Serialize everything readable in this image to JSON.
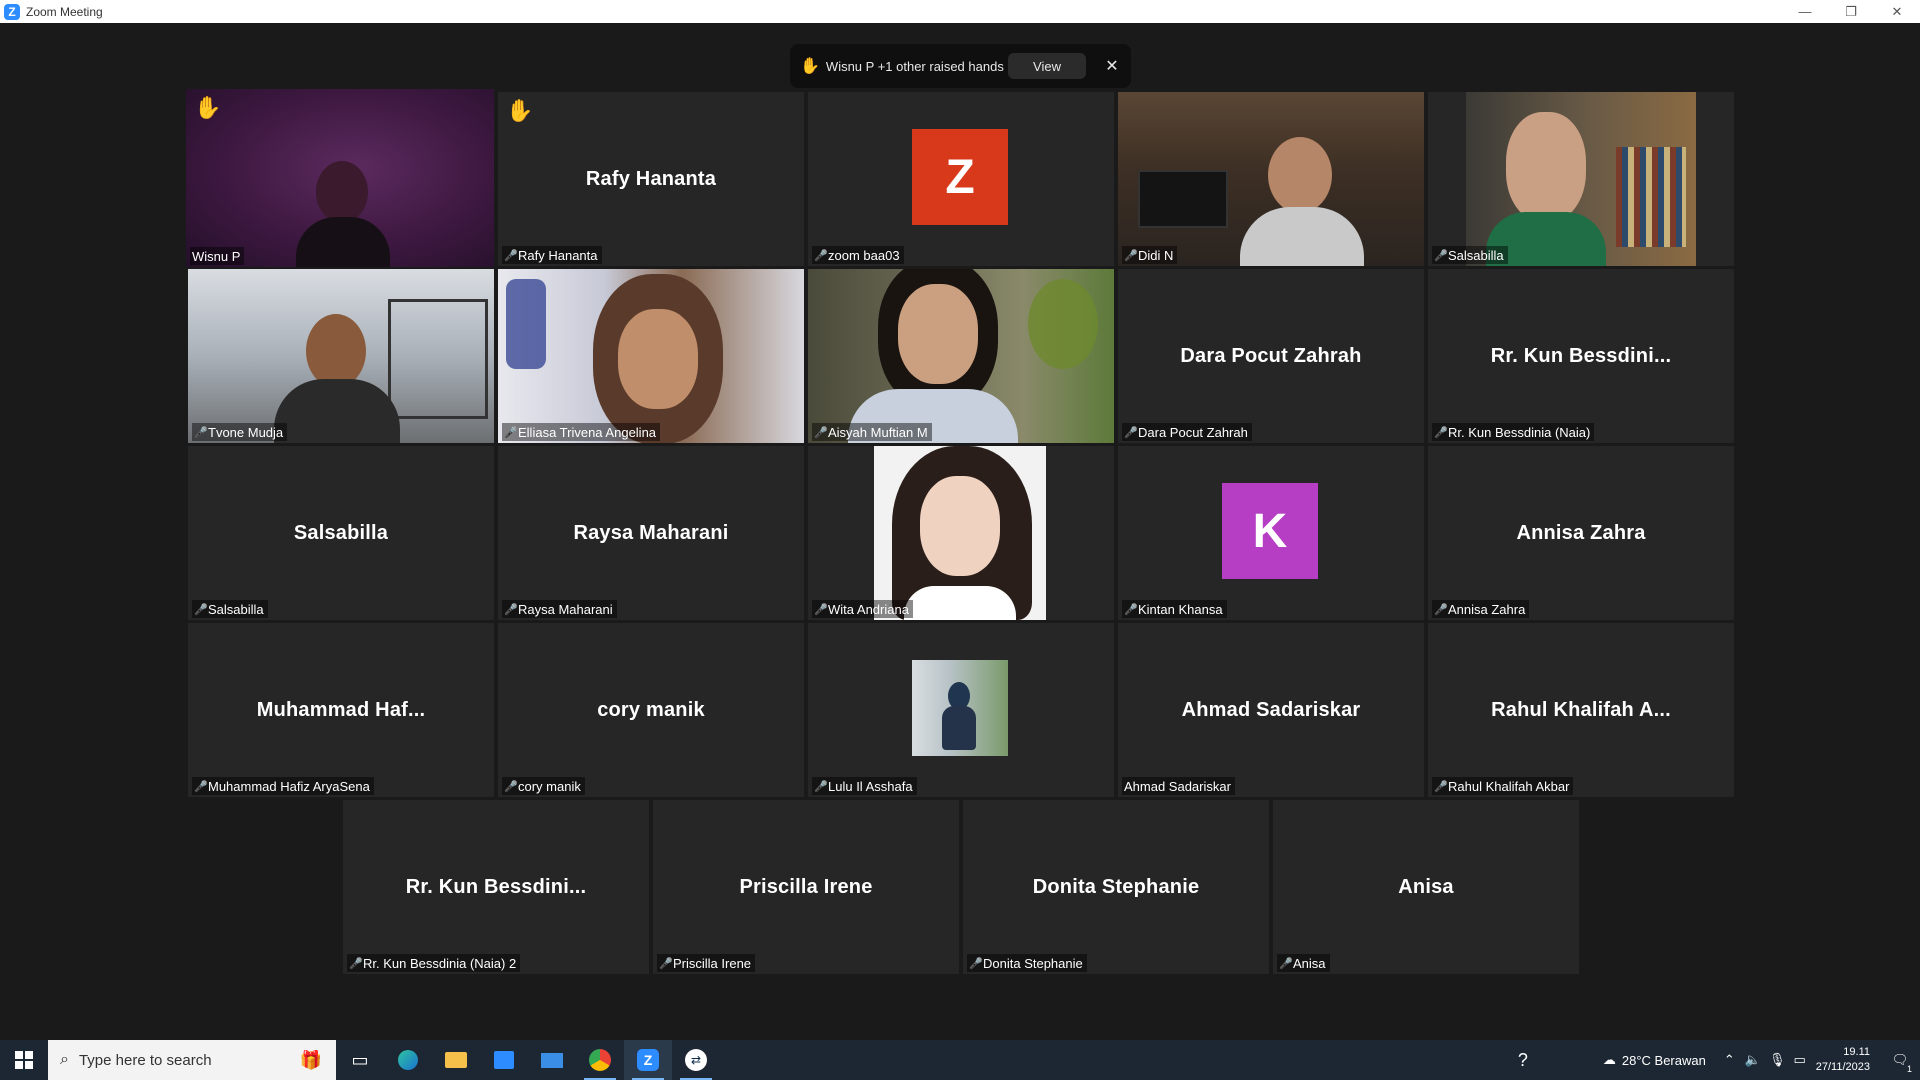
{
  "window": {
    "title": "Zoom Meeting",
    "min": "—",
    "restore": "❐",
    "close": "✕"
  },
  "notification": {
    "text": "Wisnu P +1 other raised hands",
    "view_label": "View",
    "close": "✕"
  },
  "tiles": [
    {
      "name": "Wisnu P",
      "big": "",
      "raised": true,
      "muted": false
    },
    {
      "name": "Rafy Hananta",
      "big": "Rafy Hananta",
      "raised": true,
      "muted": true
    },
    {
      "name": "zoom baa03",
      "big": "",
      "avatar_letter": "Z",
      "avatar_color": "#d9391b",
      "muted": true
    },
    {
      "name": "Didi N",
      "big": "",
      "muted": true
    },
    {
      "name": "Salsabilla",
      "big": "",
      "muted": true
    },
    {
      "name": "Tvone Mudja",
      "big": "",
      "muted": true
    },
    {
      "name": "Elliasa Trivena Angelina",
      "big": "",
      "muted": true
    },
    {
      "name": "Aisyah Muftian M",
      "big": "",
      "muted": true
    },
    {
      "name": "Dara Pocut Zahrah",
      "big": "Dara Pocut Zahrah",
      "muted": true
    },
    {
      "name": "Rr. Kun Bessdinia (Naia)",
      "big": "Rr. Kun Bessdini...",
      "muted": true
    },
    {
      "name": "Salsabilla",
      "big": "Salsabilla",
      "muted": true
    },
    {
      "name": "Raysa Maharani",
      "big": "Raysa Maharani",
      "muted": true
    },
    {
      "name": "Wita Andriana",
      "big": "",
      "muted": true
    },
    {
      "name": "Kintan Khansa",
      "big": "",
      "avatar_letter": "K",
      "avatar_color": "#b53ec4",
      "muted": true
    },
    {
      "name": "Annisa Zahra",
      "big": "Annisa Zahra",
      "muted": true
    },
    {
      "name": "Muhammad Hafiz AryaSena",
      "big": "Muhammad  Haf...",
      "muted": true
    },
    {
      "name": "cory manik",
      "big": "cory manik",
      "muted": true
    },
    {
      "name": "Lulu Il Asshafa",
      "big": "",
      "muted": true
    },
    {
      "name": "Ahmad Sadariskar",
      "big": "Ahmad Sadariskar",
      "muted": false
    },
    {
      "name": "Rahul Khalifah Akbar",
      "big": "Rahul  Khalifah  A...",
      "muted": true
    },
    {
      "name": "Rr. Kun Bessdinia (Naia) 2",
      "big": "Rr.  Kun  Bessdini...",
      "muted": true
    },
    {
      "name": "Priscilla Irene",
      "big": "Priscilla Irene",
      "muted": true
    },
    {
      "name": "Donita Stephanie",
      "big": "Donita Stephanie",
      "muted": true
    },
    {
      "name": "Anisa",
      "big": "Anisa",
      "muted": true
    }
  ],
  "taskbar": {
    "search_placeholder": "Type here to search",
    "weather": "28°C  Berawan",
    "time": "19.11",
    "date": "27/11/2023",
    "notif_count": "1"
  }
}
